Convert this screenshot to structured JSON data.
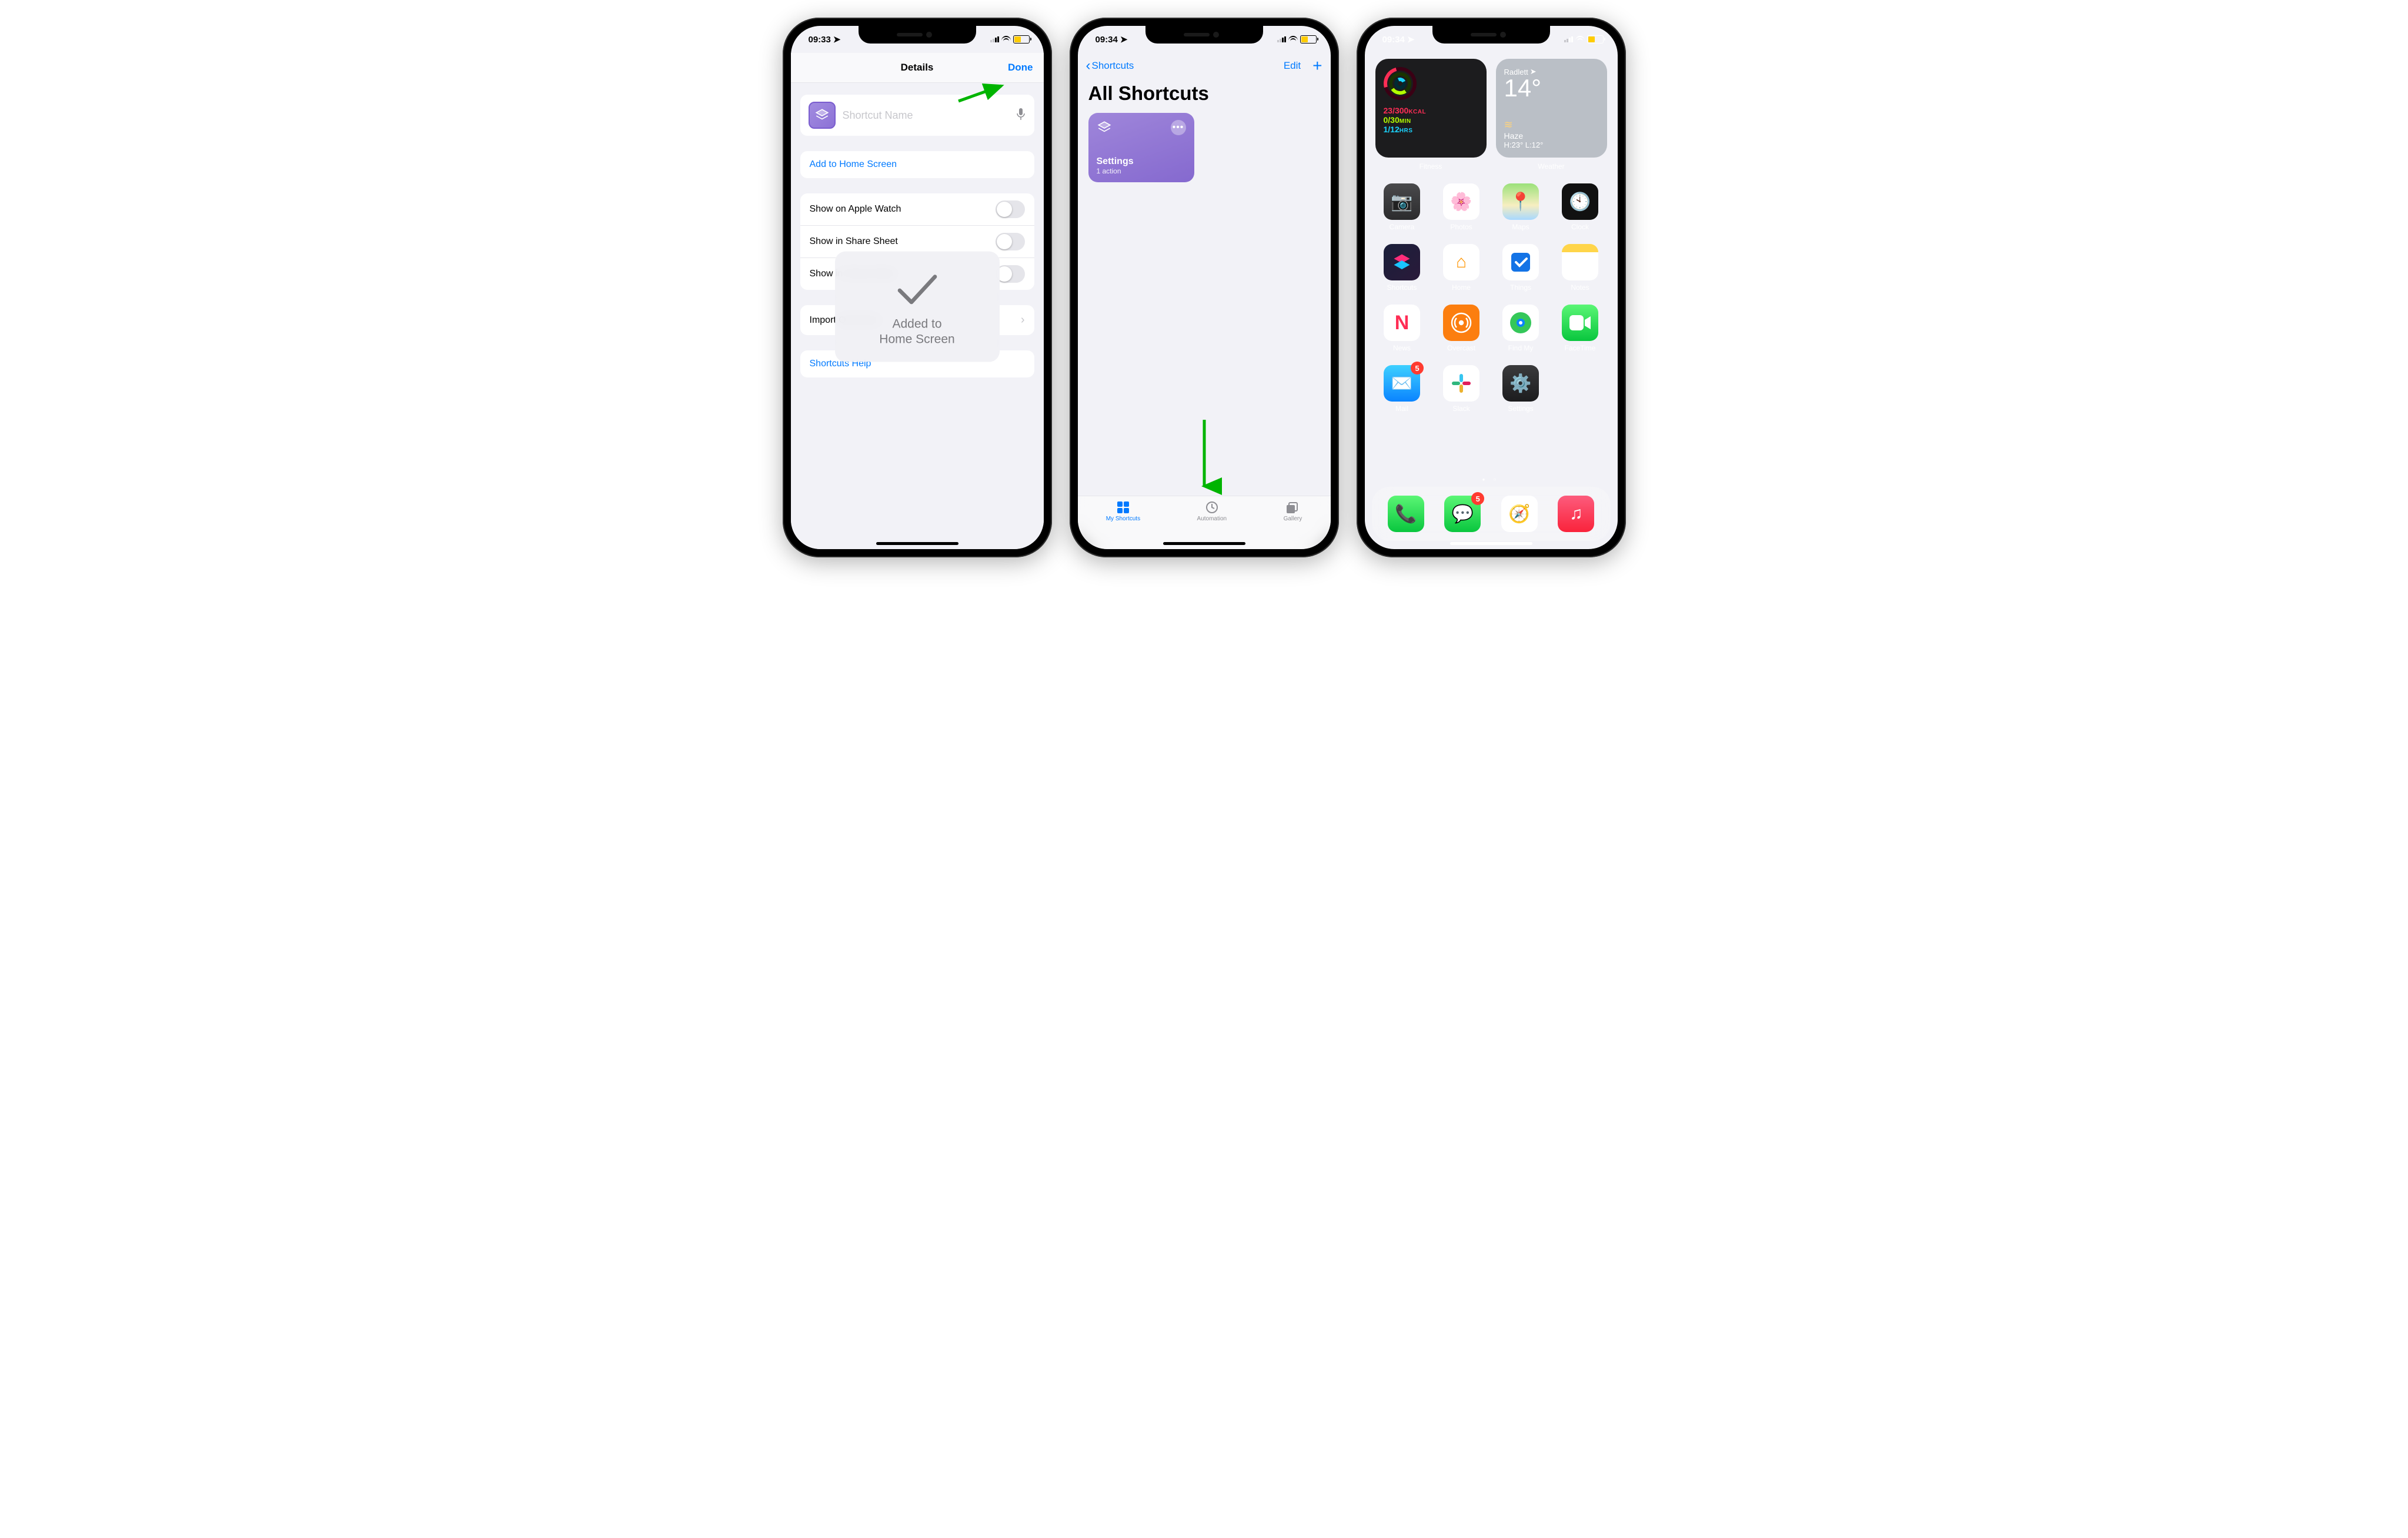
{
  "status": {
    "time1": "09:33",
    "time2": "09:34",
    "loc_glyph": "➤"
  },
  "screen1": {
    "nav_title": "Details",
    "done": "Done",
    "name_placeholder": "Shortcut Name",
    "add_home": "Add to Home Screen",
    "toggles": [
      "Show on Apple Watch",
      "Show in Share Sheet",
      "Show in Sleep Mode"
    ],
    "import_q": "Import Questions",
    "help": "Shortcuts Help",
    "overlay_line1": "Added to",
    "overlay_line2": "Home Screen"
  },
  "screen2": {
    "back": "Shortcuts",
    "edit": "Edit",
    "title": "All Shortcuts",
    "tile_name": "Settings",
    "tile_sub": "1 action",
    "tabs": {
      "my": "My Shortcuts",
      "auto": "Automation",
      "gallery": "Gallery"
    }
  },
  "screen3": {
    "fitness": {
      "label": "Fitness",
      "cal": "23/300",
      "cal_u": "KCAL",
      "ex": "0/30",
      "ex_u": "MIN",
      "st": "1/12",
      "st_u": "HRS"
    },
    "weather": {
      "label": "Weather",
      "loc": "Radlett",
      "temp": "14°",
      "cond": "Haze",
      "hilo": "H:23° L:12°"
    },
    "apps": {
      "camera": "Camera",
      "photos": "Photos",
      "maps": "Maps",
      "clock": "Clock",
      "shortcuts": "Shortcuts",
      "home": "Home",
      "things": "Things",
      "notes": "Notes",
      "news": "News",
      "overcast": "Overcast",
      "findmy": "Find My",
      "facetime": "FaceTime",
      "mail": "Mail",
      "slack": "Slack",
      "settings": "Settings"
    },
    "badges": {
      "mail": "5",
      "messages": "5"
    }
  }
}
